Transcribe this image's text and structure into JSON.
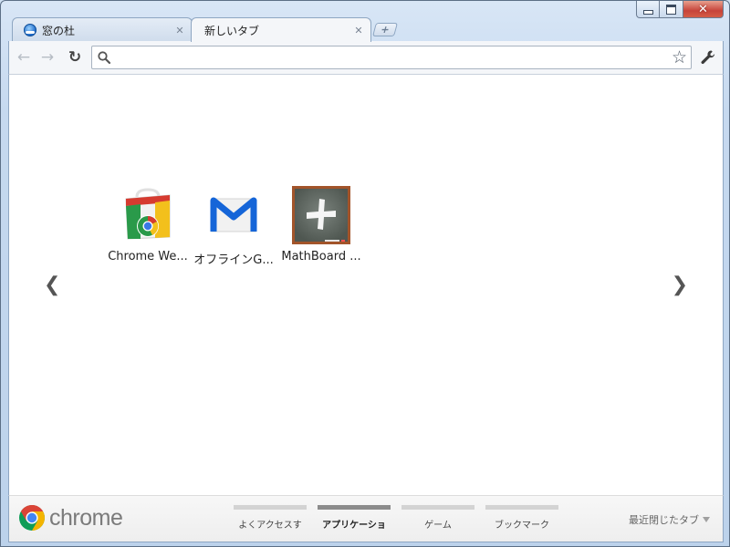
{
  "window": {
    "controls": {
      "close_glyph": "✕"
    }
  },
  "tabs": [
    {
      "title": "窓の杜",
      "close": "✕",
      "icon": "madonomori-favicon"
    },
    {
      "title": "新しいタブ",
      "close": "✕"
    }
  ],
  "newtab": {
    "glyph": "+"
  },
  "toolbar": {
    "back_glyph": "←",
    "forward_glyph": "→",
    "reload_glyph": "↻",
    "omnibox_value": "",
    "star_glyph": "☆"
  },
  "apps": [
    {
      "label": "Chrome We...",
      "icon": "chrome-web-store-icon"
    },
    {
      "label": "オフラインG...",
      "icon": "offline-gmail-icon"
    },
    {
      "label": "MathBoard ...",
      "icon": "mathboard-icon"
    }
  ],
  "pager": {
    "prev": "❮",
    "next": "❯"
  },
  "footer": {
    "brand": "chrome",
    "sections": [
      {
        "label": "よくアクセスす",
        "selected": false
      },
      {
        "label": "アプリケーショ",
        "selected": true
      },
      {
        "label": "ゲーム",
        "selected": false
      },
      {
        "label": "ブックマーク",
        "selected": false
      }
    ],
    "recent_tabs": "最近閉じたタブ"
  },
  "colors": {
    "frame": "#c6d9ef",
    "selected_section": "#8c8c8c",
    "section_bar": "#d3d3d3",
    "chrome_red": "#db4437",
    "chrome_green": "#0f9d58",
    "chrome_yellow": "#f4b400",
    "chrome_blue": "#4285f4"
  }
}
